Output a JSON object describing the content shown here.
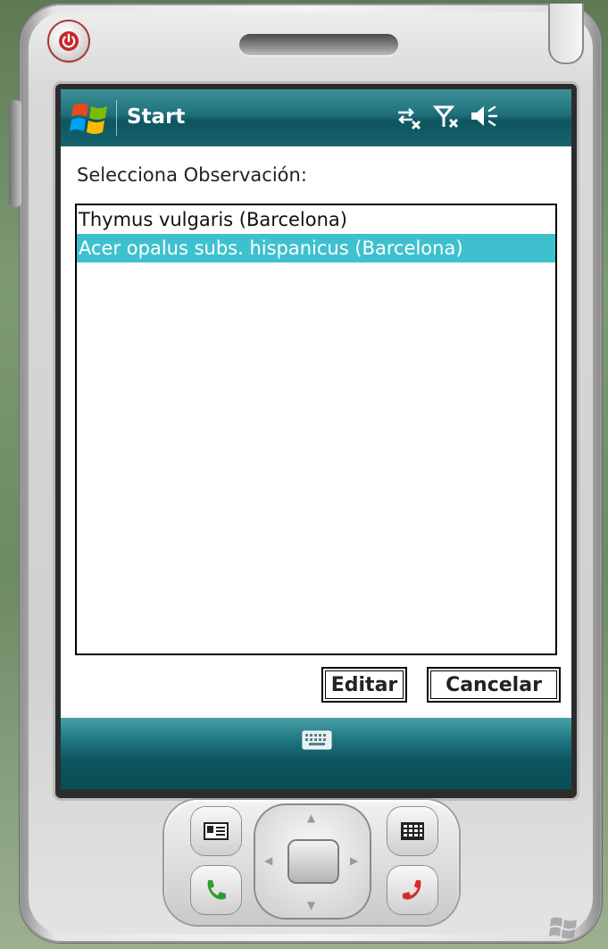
{
  "statusbar": {
    "title": "Start",
    "icons": [
      "windows-logo-icon",
      "connectivity-off-icon",
      "signal-off-icon",
      "speaker-icon"
    ]
  },
  "dialog": {
    "prompt": "Selecciona Observación:",
    "list_items": [
      {
        "label": "Thymus vulgaris (Barcelona)",
        "selected": false
      },
      {
        "label": "Acer opalus  subs. hispanicus (Barcelona)",
        "selected": true
      }
    ],
    "edit_label": "Editar",
    "cancel_label": "Cancelar"
  },
  "softbar": {
    "icon": "keyboard-icon"
  },
  "hardware": {
    "keys": [
      "power-icon",
      "contacts-icon",
      "calendar-icon",
      "call-icon",
      "end-call-icon",
      "dpad"
    ]
  },
  "colors": {
    "titlebar": "#1e6f79",
    "selection": "#3fc0cf",
    "power_ring": "#aa3333"
  }
}
